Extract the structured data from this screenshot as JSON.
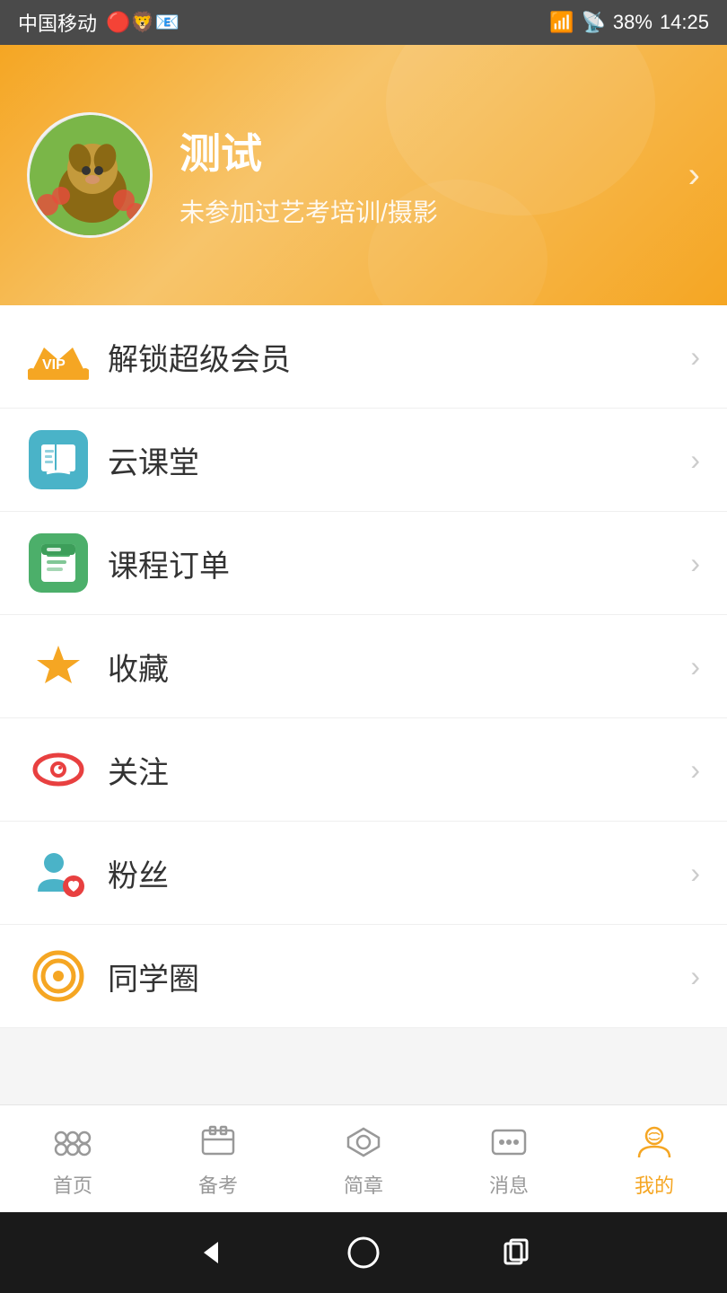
{
  "statusBar": {
    "carrier": "中国移动",
    "time": "14:25",
    "battery": "38%"
  },
  "header": {
    "userName": "测试",
    "userDesc": "未参加过艺考培训/摄影",
    "arrowLabel": ">"
  },
  "menuItems": [
    {
      "id": "vip",
      "label": "解锁超级会员",
      "iconType": "vip"
    },
    {
      "id": "cloud-class",
      "label": "云课堂",
      "iconType": "book"
    },
    {
      "id": "course-order",
      "label": "课程订单",
      "iconType": "order"
    },
    {
      "id": "favorites",
      "label": "收藏",
      "iconType": "star"
    },
    {
      "id": "follow",
      "label": "关注",
      "iconType": "eye"
    },
    {
      "id": "fans",
      "label": "粉丝",
      "iconType": "fans"
    },
    {
      "id": "circle",
      "label": "同学圈",
      "iconType": "circle"
    }
  ],
  "bottomNav": [
    {
      "id": "home",
      "label": "首页",
      "active": false
    },
    {
      "id": "prepare",
      "label": "备考",
      "active": false
    },
    {
      "id": "guide",
      "label": "简章",
      "active": false
    },
    {
      "id": "message",
      "label": "消息",
      "active": false
    },
    {
      "id": "mine",
      "label": "我的",
      "active": true
    }
  ]
}
